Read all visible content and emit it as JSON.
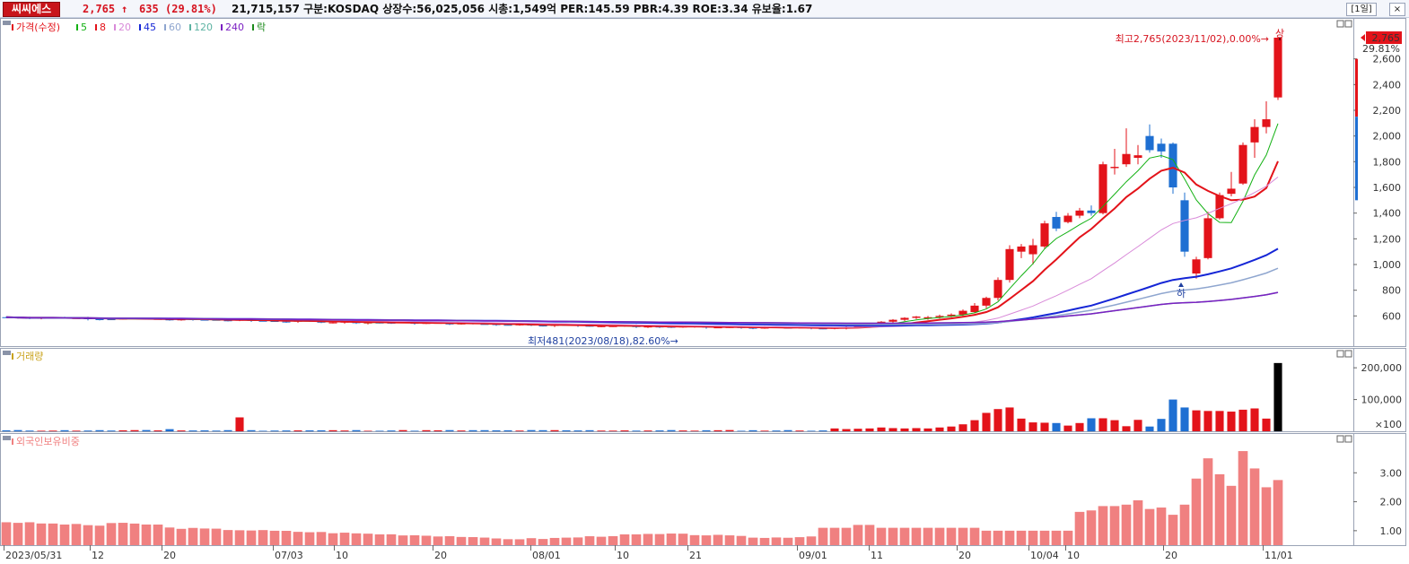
{
  "header": {
    "name": "씨씨에스",
    "price": "2,765",
    "change_arrow": "↑",
    "change": "635",
    "change_pct": "(29.81%)",
    "info": "21,715,157  구분:KOSDAQ 상장수:56,025,056 시총:1,549억 PER:145.59 PBR:4.39 ROE:3.34 유보율:1.67",
    "period_btn": "1일",
    "close_btn": "×"
  },
  "legend": {
    "price": "가격(수정)",
    "ma": [
      {
        "label": "5",
        "color": "#13b113"
      },
      {
        "label": "8",
        "color": "#e3131a"
      },
      {
        "label": "20",
        "color": "#d98ad9"
      },
      {
        "label": "45",
        "color": "#1526d6"
      },
      {
        "label": "60",
        "color": "#8fa6cf"
      },
      {
        "label": "120",
        "color": "#5db3a3"
      },
      {
        "label": "240",
        "color": "#7b1fc2"
      },
      {
        "label": "락",
        "color": "#1a8a1a"
      }
    ],
    "volume": "거래량",
    "foreign": "외국인보유비중"
  },
  "colors": {
    "up": "#e3131a",
    "down": "#1e6fd2",
    "last_volume": "#000000",
    "foreign": "#f08080"
  },
  "annotations": {
    "high": "최고2,765(2023/11/02),0.00%→",
    "high_mark": "상",
    "low": "최저481(2023/08/18),82.60%→",
    "low_mark": "하"
  },
  "price_panel": {
    "current_label": "2,765",
    "pct_label": "29.81%",
    "y_ticks": [
      "2,600",
      "2,400",
      "2,200",
      "2,000",
      "1,800",
      "1,600",
      "1,400",
      "1,200",
      "1,000",
      "800",
      "600"
    ]
  },
  "volume_panel": {
    "y_ticks": [
      "200,000",
      "100,000",
      "×100"
    ]
  },
  "foreign_panel": {
    "y_ticks": [
      "3.00",
      "2.00",
      "1.00"
    ]
  },
  "x_labels": [
    "2023/05/31",
    "12",
    "20",
    "07/03",
    "10",
    "20",
    "08/01",
    "10",
    "21",
    "09/01",
    "11",
    "20",
    "10/04",
    "10",
    "20",
    "11/01"
  ],
  "chart_data": [
    {
      "type": "candlestick",
      "title": "가격(수정)",
      "ylim": [
        400,
        2800
      ],
      "y_ticks": [
        600,
        800,
        1000,
        1200,
        1400,
        1600,
        1800,
        2000,
        2200,
        2400,
        2600
      ],
      "candles_tail": [
        {
          "o": 505,
          "h": 520,
          "l": 495,
          "c": 510
        },
        {
          "o": 510,
          "h": 530,
          "l": 505,
          "c": 525
        },
        {
          "o": 525,
          "h": 545,
          "l": 515,
          "c": 540
        },
        {
          "o": 540,
          "h": 560,
          "l": 530,
          "c": 555
        },
        {
          "o": 555,
          "h": 575,
          "l": 545,
          "c": 570
        },
        {
          "o": 570,
          "h": 590,
          "l": 560,
          "c": 585
        },
        {
          "o": 585,
          "h": 600,
          "l": 575,
          "c": 595
        },
        {
          "o": 580,
          "h": 600,
          "l": 570,
          "c": 590
        },
        {
          "o": 590,
          "h": 610,
          "l": 580,
          "c": 600
        },
        {
          "o": 600,
          "h": 620,
          "l": 590,
          "c": 610
        },
        {
          "o": 610,
          "h": 650,
          "l": 600,
          "c": 640
        },
        {
          "o": 630,
          "h": 700,
          "l": 620,
          "c": 680
        },
        {
          "o": 680,
          "h": 750,
          "l": 660,
          "c": 740
        },
        {
          "o": 740,
          "h": 900,
          "l": 720,
          "c": 880
        },
        {
          "o": 880,
          "h": 1150,
          "l": 860,
          "c": 1120
        },
        {
          "o": 1100,
          "h": 1160,
          "l": 1050,
          "c": 1140
        },
        {
          "o": 1080,
          "h": 1200,
          "l": 1000,
          "c": 1150
        },
        {
          "o": 1140,
          "h": 1340,
          "l": 1120,
          "c": 1320
        },
        {
          "o": 1370,
          "h": 1410,
          "l": 1260,
          "c": 1280
        },
        {
          "o": 1330,
          "h": 1400,
          "l": 1320,
          "c": 1380
        },
        {
          "o": 1380,
          "h": 1440,
          "l": 1360,
          "c": 1420
        },
        {
          "o": 1420,
          "h": 1460,
          "l": 1380,
          "c": 1400
        },
        {
          "o": 1400,
          "h": 1800,
          "l": 1390,
          "c": 1780
        },
        {
          "o": 1750,
          "h": 1900,
          "l": 1700,
          "c": 1760
        },
        {
          "o": 1780,
          "h": 2060,
          "l": 1760,
          "c": 1860
        },
        {
          "o": 1830,
          "h": 1930,
          "l": 1780,
          "c": 1850
        },
        {
          "o": 2000,
          "h": 2090,
          "l": 1870,
          "c": 1890
        },
        {
          "o": 1940,
          "h": 1980,
          "l": 1830,
          "c": 1880
        },
        {
          "o": 1940,
          "h": 1950,
          "l": 1550,
          "c": 1600
        },
        {
          "o": 1500,
          "h": 1560,
          "l": 1060,
          "c": 1100
        },
        {
          "o": 930,
          "h": 1060,
          "l": 890,
          "c": 1040
        },
        {
          "o": 1050,
          "h": 1410,
          "l": 1040,
          "c": 1360
        },
        {
          "o": 1360,
          "h": 1560,
          "l": 1350,
          "c": 1540
        },
        {
          "o": 1550,
          "h": 1720,
          "l": 1530,
          "c": 1590
        },
        {
          "o": 1630,
          "h": 1950,
          "l": 1620,
          "c": 1930
        },
        {
          "o": 1950,
          "h": 2130,
          "l": 1830,
          "c": 2070
        },
        {
          "o": 2070,
          "h": 2270,
          "l": 2020,
          "c": 2130
        },
        {
          "o": 2300,
          "h": 2765,
          "l": 2280,
          "c": 2765
        }
      ]
    },
    {
      "type": "bar",
      "title": "거래량",
      "ylim": [
        0,
        240000
      ],
      "y_ticks": [
        100000,
        200000
      ],
      "values_tail": [
        9000,
        7000,
        8000,
        9000,
        12000,
        10000,
        9000,
        10000,
        9000,
        12000,
        15000,
        22000,
        35000,
        58000,
        70000,
        75000,
        40000,
        28000,
        27000,
        26000,
        18000,
        26000,
        41000,
        41000,
        35000,
        16000,
        36000,
        15000,
        39000,
        100000,
        75000,
        66000,
        64000,
        64000,
        62000,
        68000,
        72000,
        40000,
        215000
      ]
    },
    {
      "type": "bar",
      "title": "외국인보유비중",
      "ylim": [
        0.5,
        4.0
      ],
      "y_ticks": [
        1.0,
        2.0,
        3.0
      ],
      "values_tail": [
        1.1,
        1.1,
        1.1,
        1.2,
        1.2,
        1.1,
        1.1,
        1.1,
        1.1,
        1.1,
        1.1,
        1.1,
        1.1,
        1.1,
        1.0,
        1.0,
        1.0,
        1.0,
        1.0,
        1.0,
        1.0,
        1.0,
        1.65,
        1.7,
        1.85,
        1.85,
        1.9,
        2.05,
        1.75,
        1.8,
        1.55,
        1.9,
        2.8,
        3.5,
        2.95,
        2.55,
        3.75,
        3.15,
        2.5,
        2.75
      ]
    }
  ]
}
